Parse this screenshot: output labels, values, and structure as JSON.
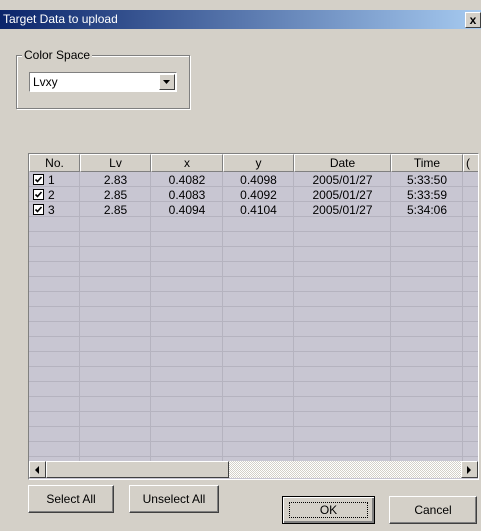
{
  "window": {
    "title": "Target Data to upload",
    "close_glyph": "x"
  },
  "color_space": {
    "group_label": "Color Space",
    "selected": "Lvxy"
  },
  "table": {
    "columns": [
      "No.",
      "Lv",
      "x",
      "y",
      "Date",
      "Time",
      "("
    ],
    "rows": [
      {
        "checked": true,
        "no": "1",
        "lv": "2.83",
        "x": "0.4082",
        "y": "0.4098",
        "date": "2005/01/27",
        "time": "5:33:50"
      },
      {
        "checked": true,
        "no": "2",
        "lv": "2.85",
        "x": "0.4083",
        "y": "0.4092",
        "date": "2005/01/27",
        "time": "5:33:59"
      },
      {
        "checked": true,
        "no": "3",
        "lv": "2.85",
        "x": "0.4094",
        "y": "0.4104",
        "date": "2005/01/27",
        "time": "5:34:06"
      }
    ]
  },
  "buttons": {
    "select_all": "Select All",
    "unselect_all": "Unselect All",
    "ok": "OK",
    "cancel": "Cancel"
  },
  "colors": {
    "title_bar": "#0a246a",
    "list_background": "#c8c6d2",
    "face": "#d4d0c8"
  }
}
